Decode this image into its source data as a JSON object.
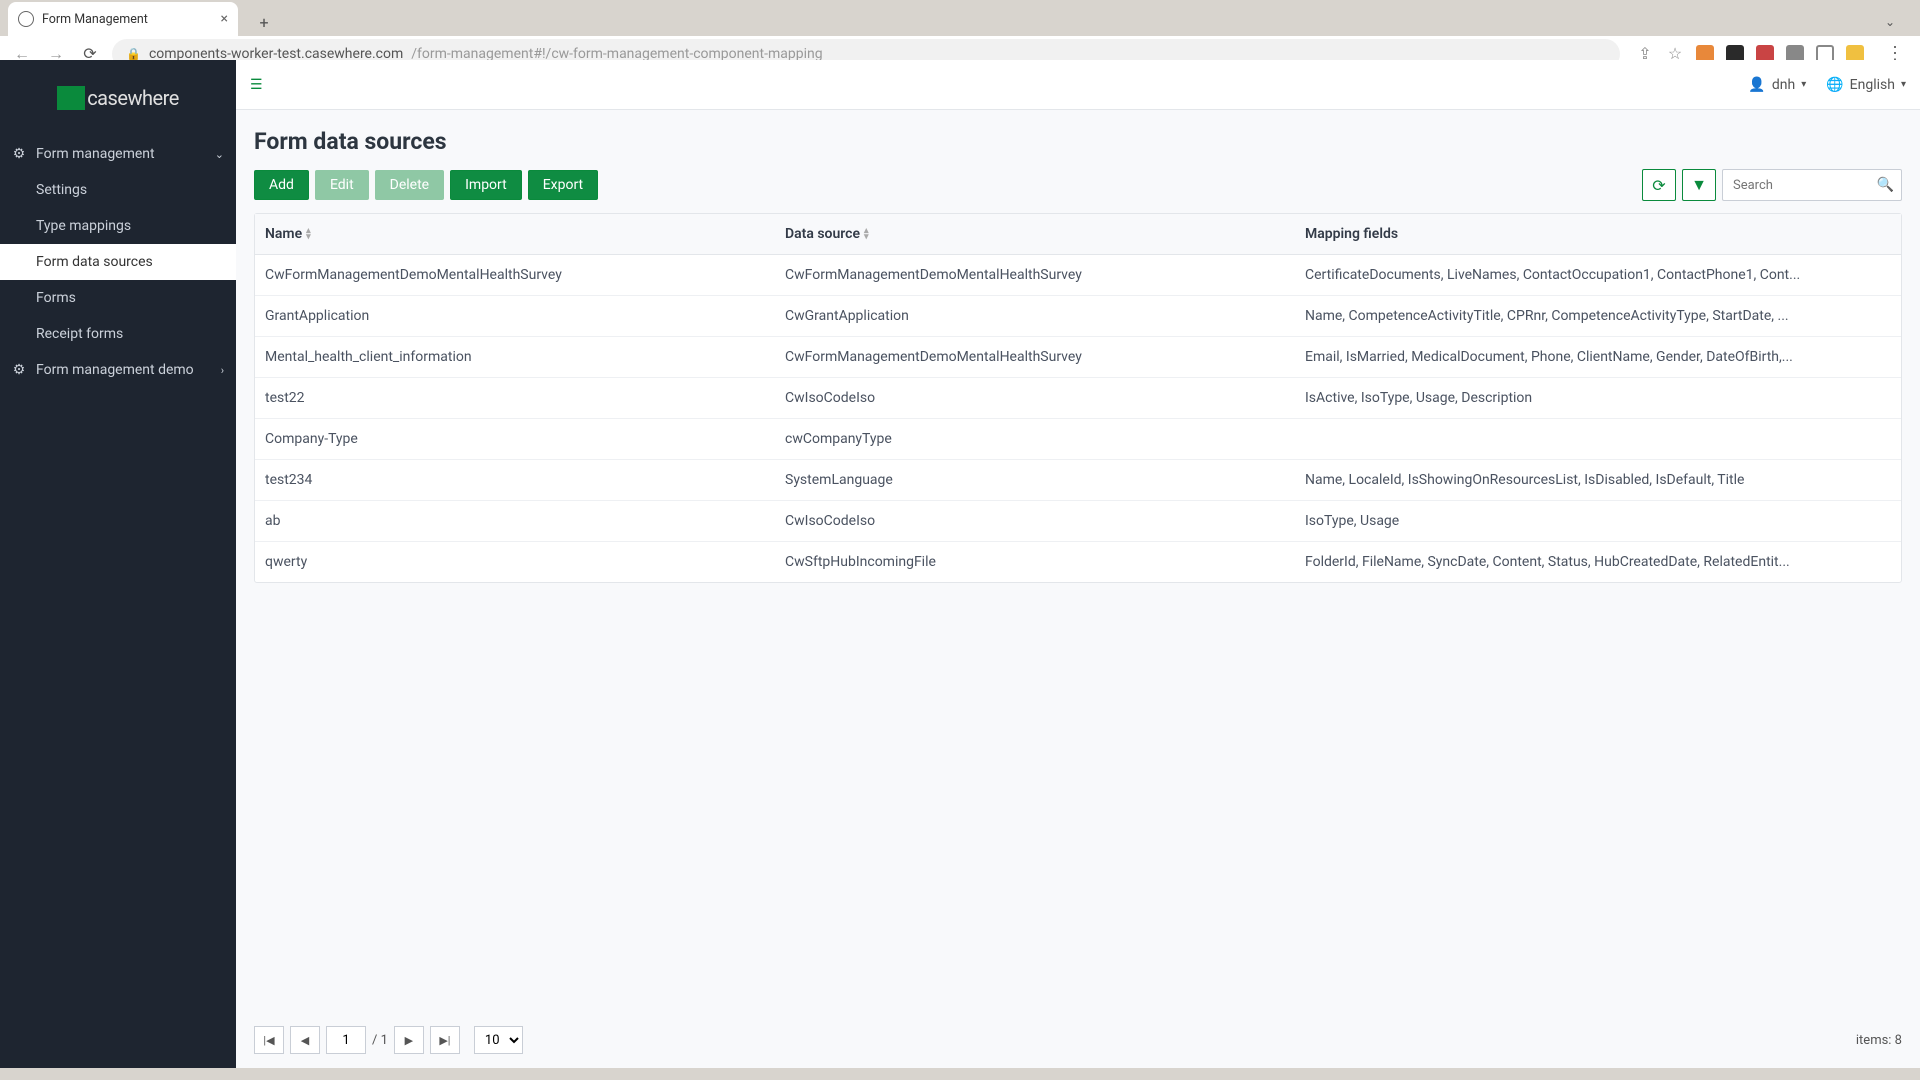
{
  "browser": {
    "tab_title": "Form Management",
    "url_host": "components-worker-test.casewhere.com",
    "url_path": "/form-management#!/cw-form-management-component-mapping"
  },
  "logo_text": "casewhere",
  "sidebar": {
    "group1": {
      "label": "Form management"
    },
    "items": [
      {
        "label": "Settings"
      },
      {
        "label": "Type mappings"
      },
      {
        "label": "Form data sources"
      },
      {
        "label": "Forms"
      },
      {
        "label": "Receipt forms"
      }
    ],
    "group2": {
      "label": "Form management demo"
    }
  },
  "topbar": {
    "user": "dnh",
    "language": "English"
  },
  "page_title": "Form data sources",
  "buttons": {
    "add": "Add",
    "edit": "Edit",
    "delete": "Delete",
    "import": "Import",
    "export": "Export"
  },
  "search_placeholder": "Search",
  "columns": {
    "name": "Name",
    "data_source": "Data source",
    "mapping_fields": "Mapping fields"
  },
  "rows": [
    {
      "name": "CwFormManagementDemoMentalHealthSurvey",
      "ds": "CwFormManagementDemoMentalHealthSurvey",
      "map": "CertificateDocuments, LiveNames, ContactOccupation1, ContactPhone1, Cont..."
    },
    {
      "name": "GrantApplication",
      "ds": "CwGrantApplication",
      "map": "Name, CompetenceActivityTitle, CPRnr, CompetenceActivityType, StartDate, ..."
    },
    {
      "name": "Mental_health_client_information",
      "ds": "CwFormManagementDemoMentalHealthSurvey",
      "map": "Email, IsMarried, MedicalDocument, Phone, ClientName, Gender, DateOfBirth,..."
    },
    {
      "name": "test22",
      "ds": "CwIsoCodeIso",
      "map": "IsActive, IsoType, Usage, Description"
    },
    {
      "name": "Company-Type",
      "ds": "cwCompanyType",
      "map": ""
    },
    {
      "name": "test234",
      "ds": "SystemLanguage",
      "map": "Name, LocaleId, IsShowingOnResourcesList, IsDisabled, IsDefault, Title"
    },
    {
      "name": "ab",
      "ds": "CwIsoCodeIso",
      "map": "IsoType, Usage"
    },
    {
      "name": "qwerty",
      "ds": "CwSftpHubIncomingFile",
      "map": "FolderId, FileName, SyncDate, Content, Status, HubCreatedDate, RelatedEntit..."
    }
  ],
  "pager": {
    "page": "1",
    "of": "/ 1",
    "page_size": "10",
    "items_label": "items: 8"
  }
}
